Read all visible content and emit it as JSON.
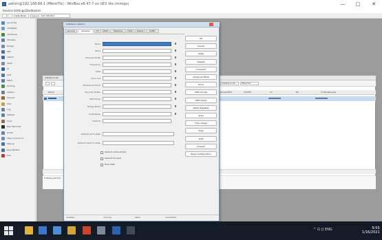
{
  "window": {
    "title": "admin@192.168.88.1 (MikroTik) - WinBox v6.47.7 on hEX lite (mmips)",
    "minimize": "—",
    "maximize": "□",
    "close": "✕"
  },
  "menu": [
    "Session",
    "Settings",
    "Dashboard"
  ],
  "toolbar": {
    "session_label": "Safe Mode",
    "session_value": "Session: 192.168.88.1"
  },
  "sidebar": [
    {
      "label": "Quick Set",
      "icon": "quick-set-icon",
      "color": "#4a8bd0"
    },
    {
      "label": "CAPsMAN",
      "icon": "capsman-icon",
      "color": "#7a9bbf"
    },
    {
      "label": "Interfaces",
      "icon": "interfaces-icon",
      "color": "#3f8a3f"
    },
    {
      "label": "Wireless",
      "icon": "wireless-icon",
      "color": "#5d7fa6"
    },
    {
      "label": "Bridge",
      "icon": "bridge-icon",
      "color": "#6a8fb8"
    },
    {
      "label": "PPP",
      "icon": "ppp-icon",
      "color": "#4f6f9a"
    },
    {
      "label": "Switch",
      "icon": "switch-icon",
      "color": "#3d6fa3"
    },
    {
      "label": "Mesh",
      "icon": "mesh-icon",
      "color": "#7b8ba0"
    },
    {
      "label": "IP",
      "icon": "ip-icon",
      "color": "#2f63a8"
    },
    {
      "label": "IPv6",
      "icon": "ipv6-icon",
      "color": "#4d76ad"
    },
    {
      "label": "MPLS",
      "icon": "mpls-icon",
      "color": "#5a7aa8"
    },
    {
      "label": "Routing",
      "icon": "routing-icon",
      "color": "#4f8a4f"
    },
    {
      "label": "System",
      "icon": "system-icon",
      "color": "#6d7d93"
    },
    {
      "label": "Queues",
      "icon": "queues-icon",
      "color": "#a35f2b"
    },
    {
      "label": "Files",
      "icon": "files-icon",
      "color": "#c2a142"
    },
    {
      "label": "Log",
      "icon": "log-icon",
      "color": "#6c7f99"
    },
    {
      "label": "RADIUS",
      "icon": "radius-icon",
      "color": "#5b7ea8"
    },
    {
      "label": "Tools",
      "icon": "tools-icon",
      "color": "#8d6f4a"
    },
    {
      "label": "New Terminal",
      "icon": "terminal-icon",
      "color": "#2d2d2d"
    },
    {
      "label": "Dot1X",
      "icon": "dot1x-icon",
      "color": "#6385ad"
    },
    {
      "label": "Make Supout.rif",
      "icon": "supout-icon",
      "color": "#7290b6"
    },
    {
      "label": "Manual",
      "icon": "manual-icon",
      "color": "#3f74b4"
    },
    {
      "label": "New WinBox",
      "icon": "winbox-icon",
      "color": "#4e6f98"
    },
    {
      "label": "Exit",
      "icon": "exit-icon",
      "color": "#b03a3a"
    }
  ],
  "list_window": {
    "title": "Interface List",
    "tabs": [
      "Interface",
      "Interface List",
      "Ethernet",
      "EoIP Tunnel"
    ],
    "columns": [
      "Name",
      "Type",
      "Actual MTU",
      "L2 MTU",
      "Tx",
      "Rx",
      "Tx Packet (p/s)"
    ],
    "footer": "5 items out of 9"
  },
  "dialog": {
    "title": "Interface <wlan1>",
    "tabs": [
      "General",
      "Wireless",
      "HT",
      "WDS",
      "Nstreme",
      "NV2",
      "Status",
      "Traffic"
    ],
    "fields": [
      {
        "label": "Mode"
      },
      {
        "label": "Band"
      },
      {
        "label": "Channel Width"
      },
      {
        "label": "Frequency"
      },
      {
        "label": "SSID"
      },
      {
        "label": "Scan List"
      },
      {
        "label": "Wireless Protocol"
      },
      {
        "label": "Security Profile"
      },
      {
        "label": "WPS Mode"
      },
      {
        "label": "Bridge Mode"
      },
      {
        "label": "VLAN Mode"
      },
      {
        "label": "VLAN ID"
      },
      {
        "label": "Default AP Tx Rate"
      },
      {
        "label": "Default Client Tx Rate"
      }
    ],
    "checkboxes": [
      {
        "label": "Default Authenticate"
      },
      {
        "label": "Default Forward"
      },
      {
        "label": "Hide SSID"
      }
    ],
    "status_bar": [
      "enabled",
      "running",
      "slave",
      "connected"
    ]
  },
  "side_buttons": [
    "OK",
    "Cancel",
    "Apply",
    "Disable",
    "Comment",
    "Advanced Mode",
    "Torch",
    "WPS Accept",
    "WPS Client",
    "Setup Repeater",
    "Scan",
    "Freq. Usage",
    "Align",
    "Sniff",
    "Snooper",
    "Reset Configuration"
  ],
  "taskbar": {
    "apps": [
      {
        "name": "file-explorer-icon",
        "color": "#e2b33c"
      },
      {
        "name": "store-icon",
        "color": "#3a77c8"
      },
      {
        "name": "mail-icon",
        "color": "#4d8fd6"
      },
      {
        "name": "browser-icon",
        "color": "#d2a33a"
      },
      {
        "name": "media-icon",
        "color": "#c8452f"
      },
      {
        "name": "settings-icon",
        "color": "#7a8a9b"
      },
      {
        "name": "winbox-task-icon",
        "color": "#2c62b0"
      },
      {
        "name": "terminal-task-icon",
        "color": "#3f4a5a"
      }
    ],
    "tray": "^  ⊡  ))  ENG",
    "time": "9:55",
    "date": "1/16/2021"
  }
}
